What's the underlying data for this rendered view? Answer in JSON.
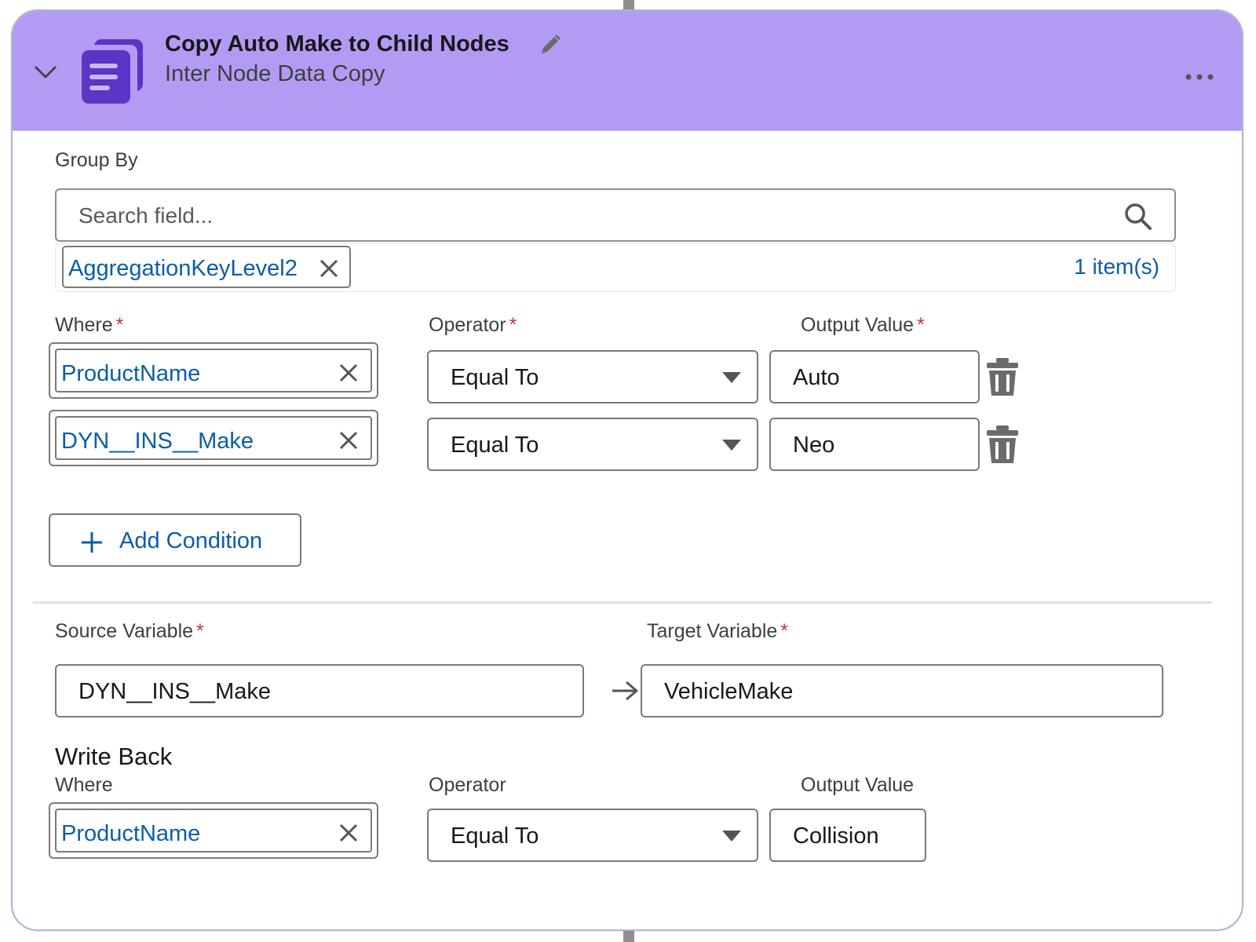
{
  "node": {
    "title": "Copy Auto Make to Child Nodes",
    "subtitle": "Inter Node Data Copy",
    "header_color": "#b39bf4",
    "icon_color": "#5a35c6"
  },
  "group_by": {
    "label": "Group By",
    "search_placeholder": "Search field...",
    "selected": [
      "AggregationKeyLevel2"
    ],
    "count_label": "1 item(s)"
  },
  "conditions": {
    "where_label": "Where",
    "operator_label": "Operator",
    "output_label": "Output Value",
    "required_mark": "*",
    "rows": [
      {
        "field": "ProductName",
        "operator": "Equal To",
        "value": "Auto"
      },
      {
        "field": "DYN__INS__Make",
        "operator": "Equal To",
        "value": "Neo"
      }
    ],
    "add_condition_label": "Add Condition"
  },
  "mapping": {
    "source_label": "Source Variable",
    "source_value": "DYN__INS__Make",
    "target_label": "Target Variable",
    "target_value": "VehicleMake"
  },
  "write_back": {
    "title": "Write Back",
    "where_label": "Where",
    "operator_label": "Operator",
    "output_label": "Output Value",
    "field": "ProductName",
    "operator": "Equal To",
    "value": "Collision"
  }
}
